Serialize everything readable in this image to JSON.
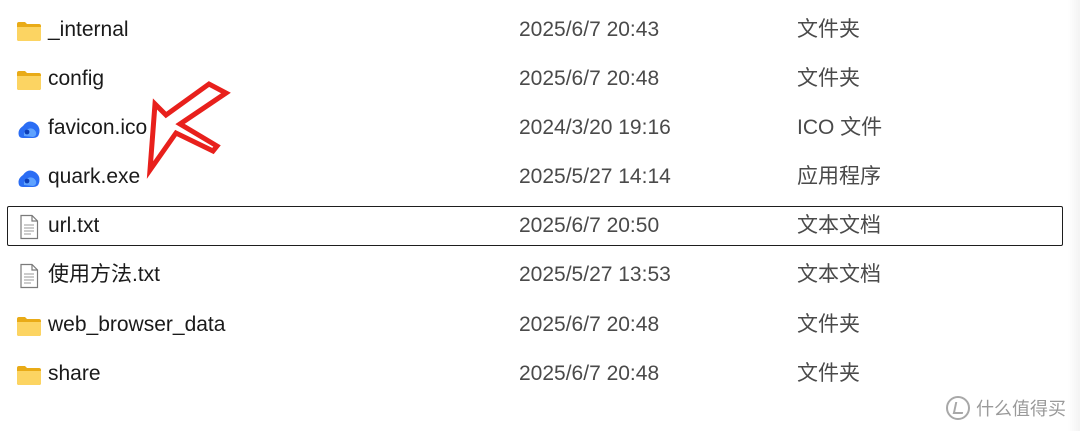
{
  "files": [
    {
      "name": "_internal",
      "date": "2025/6/7 20:43",
      "type": "文件夹",
      "icon": "folder-icon"
    },
    {
      "name": "config",
      "date": "2025/6/7 20:48",
      "type": "文件夹",
      "icon": "folder-icon"
    },
    {
      "name": "favicon.ico",
      "date": "2024/3/20 19:16",
      "type": "ICO 文件",
      "icon": "quark-app-icon"
    },
    {
      "name": "quark.exe",
      "date": "2025/5/27 14:14",
      "type": "应用程序",
      "icon": "quark-app-icon"
    },
    {
      "name": "url.txt",
      "date": "2025/6/7 20:50",
      "type": "文本文档",
      "icon": "text-file-icon",
      "selected": true
    },
    {
      "name": "使用方法.txt",
      "date": "2025/5/27 13:53",
      "type": "文本文档",
      "icon": "text-file-icon"
    },
    {
      "name": "web_browser_data",
      "date": "2025/6/7 20:48",
      "type": "文件夹",
      "icon": "folder-icon"
    },
    {
      "name": "share",
      "date": "2025/6/7 20:48",
      "type": "文件夹",
      "icon": "folder-icon"
    }
  ],
  "watermark": {
    "text": "什么值得买",
    "icon": "smzdm-logo-icon"
  },
  "annotation": {
    "icon": "red-arrow-icon",
    "color": "#e8201c"
  },
  "colors": {
    "folder": "#f8c542",
    "quark": "#2a6df4",
    "selection_border": "#1e1e1e"
  }
}
